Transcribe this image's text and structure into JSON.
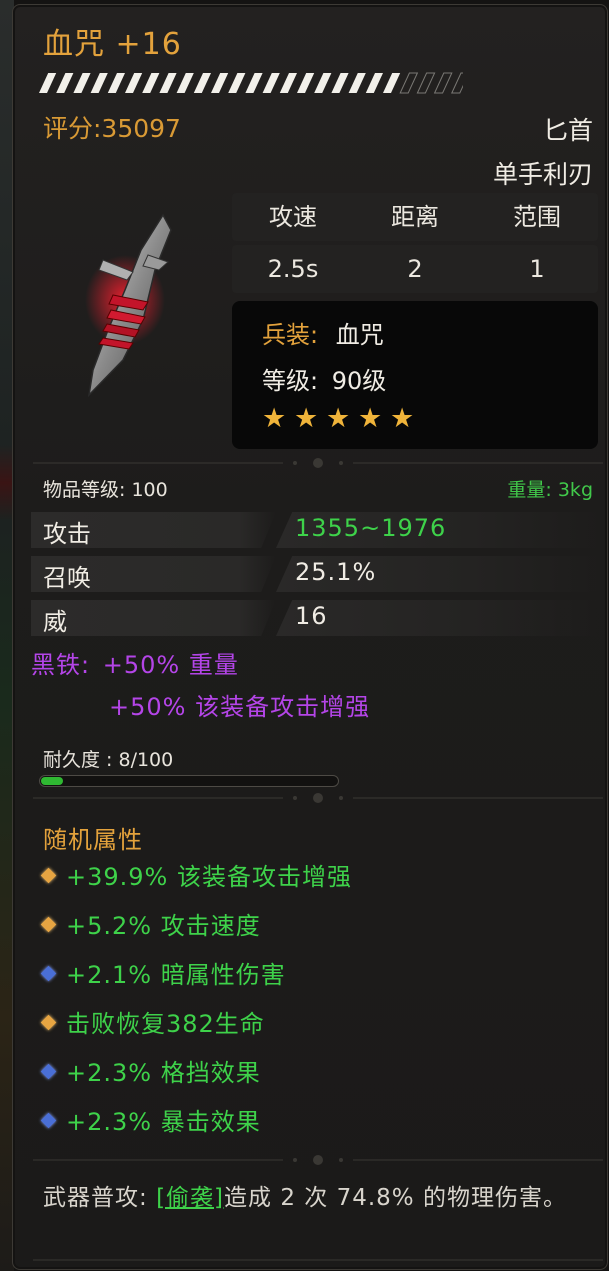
{
  "item": {
    "title": "血咒 +16",
    "score": "评分:35097",
    "weapon_type": "匕首",
    "handedness": "单手利刃",
    "experience_fill": 0.82
  },
  "stats_table": {
    "headers": [
      "攻速",
      "距离",
      "范围"
    ],
    "values": [
      "2.5s",
      "2",
      "1"
    ]
  },
  "info": {
    "equip_label": "兵装:",
    "equip_value": "血咒",
    "level_label": "等级:",
    "level_value": "90级",
    "stars": 5
  },
  "meta": {
    "item_level": "物品等级: 100",
    "weight": "重量: 3kg"
  },
  "attributes": [
    {
      "name": "攻击",
      "value": "1355~1976"
    },
    {
      "name": "召唤",
      "value": "25.1%"
    },
    {
      "name": "威",
      "value": "16"
    }
  ],
  "black_iron": {
    "label": "黑铁:",
    "line1": "+50% 重量",
    "line2": "+50% 该装备攻击增强"
  },
  "durability": {
    "label": "耐久度 : 8/100",
    "fraction": 0.08
  },
  "random_attributes": {
    "title": "随机属性",
    "items": [
      {
        "gem": "gold-gem-icon",
        "text": "+39.9% 该装备攻击增强"
      },
      {
        "gem": "gold-gem-icon",
        "text": "+5.2% 攻击速度"
      },
      {
        "gem": "blue-gem-icon",
        "text": "+2.1% 暗属性伤害"
      },
      {
        "gem": "gold-gem-icon",
        "text": "击败恢复382生命"
      },
      {
        "gem": "blue-gem-icon",
        "text": "+2.3% 格挡效果"
      },
      {
        "gem": "blue-gem-icon",
        "text": "+2.3% 暴击效果"
      }
    ]
  },
  "description": {
    "prefix": "武器普攻: ",
    "skill": "[偷袭]",
    "suffix": "造成 2 次 74.8% 的物理伤害。"
  },
  "colors": {
    "gold": "#e3a23c",
    "green": "#3ed24a",
    "purple": "#b445e8"
  }
}
